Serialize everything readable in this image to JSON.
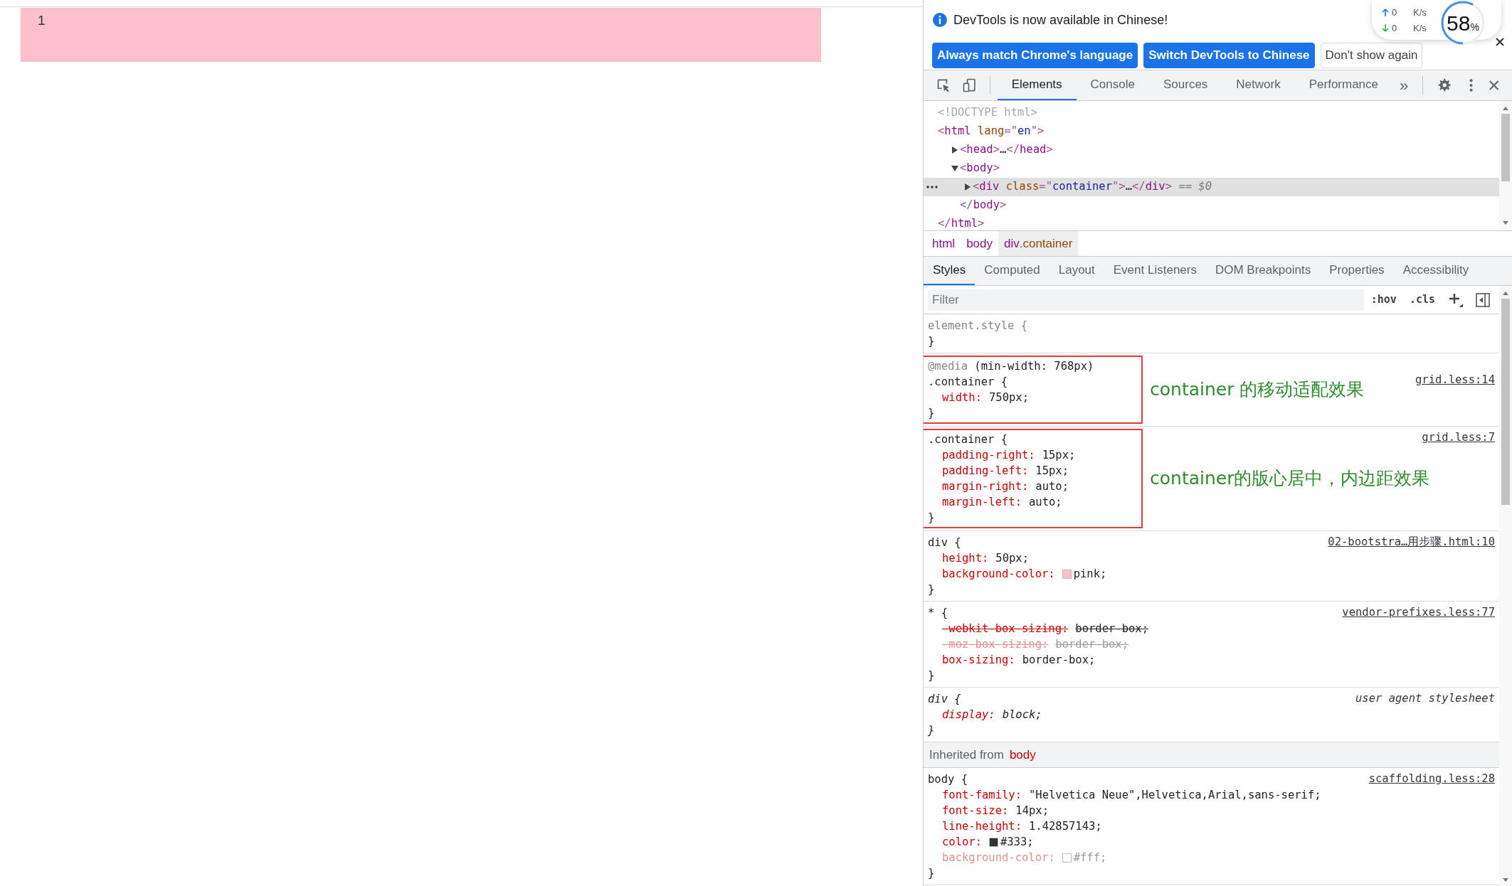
{
  "page": {
    "content_text": "1"
  },
  "infobar": {
    "message": "DevTools is now available in Chinese!",
    "buttons": [
      {
        "label": "Always match Chrome's language",
        "kind": "primary"
      },
      {
        "label": "Switch DevTools to Chinese",
        "kind": "primary"
      },
      {
        "label": "Don't show again",
        "kind": "secondary"
      }
    ]
  },
  "speed_widget": {
    "upload": "0",
    "upload_unit": "K/s",
    "download": "0",
    "download_unit": "K/s",
    "percent": "58",
    "percent_sign": "%",
    "level": 0.58
  },
  "toolbar": {
    "tabs": [
      {
        "label": "Elements",
        "selected": true
      },
      {
        "label": "Console",
        "selected": false
      },
      {
        "label": "Sources",
        "selected": false
      },
      {
        "label": "Network",
        "selected": false
      },
      {
        "label": "Performance",
        "selected": false
      }
    ],
    "more": "»"
  },
  "dom_tree": [
    {
      "tokens": [
        {
          "kind": "doctype",
          "text": "<!DOCTYPE html>"
        }
      ],
      "selected": false
    },
    {
      "tokens": [
        {
          "kind": "punct",
          "text": "<"
        },
        {
          "kind": "tag",
          "text": "html"
        },
        {
          "kind": "attr",
          "text": " lang"
        },
        {
          "kind": "punct",
          "text": "=\""
        },
        {
          "kind": "value",
          "text": "en"
        },
        {
          "kind": "punct",
          "text": "\">"
        }
      ],
      "selected": false,
      "children": [
        {
          "tokens": [
            {
              "kind": "punct",
              "text": "<"
            },
            {
              "kind": "tag",
              "text": "head"
            },
            {
              "kind": "punct",
              "text": ">"
            },
            {
              "kind": "plain",
              "text": "…"
            },
            {
              "kind": "punct",
              "text": "</"
            },
            {
              "kind": "tag",
              "text": "head"
            },
            {
              "kind": "punct",
              "text": ">"
            }
          ],
          "expanded": false,
          "selected": false
        },
        {
          "tokens": [
            {
              "kind": "punct",
              "text": "<"
            },
            {
              "kind": "tag",
              "text": "body"
            },
            {
              "kind": "punct",
              "text": ">"
            }
          ],
          "expanded": true,
          "selected": false,
          "children": [
            {
              "tokens": [
                {
                  "kind": "punct",
                  "text": "<"
                },
                {
                  "kind": "tag",
                  "text": "div"
                },
                {
                  "kind": "attr",
                  "text": " class"
                },
                {
                  "kind": "punct",
                  "text": "=\""
                },
                {
                  "kind": "value",
                  "text": "container"
                },
                {
                  "kind": "punct",
                  "text": "\">"
                },
                {
                  "kind": "plain",
                  "text": "…"
                },
                {
                  "kind": "punct",
                  "text": "</"
                },
                {
                  "kind": "tag",
                  "text": "div"
                },
                {
                  "kind": "punct",
                  "text": ">"
                },
                {
                  "kind": "marker",
                  "text": " == $0"
                }
              ],
              "expanded": false,
              "selected": true
            }
          ],
          "closing": [
            {
              "kind": "punct",
              "text": "</"
            },
            {
              "kind": "tag",
              "text": "body"
            },
            {
              "kind": "punct",
              "text": ">"
            }
          ]
        }
      ],
      "closing": [
        {
          "kind": "punct",
          "text": "</"
        },
        {
          "kind": "tag",
          "text": "html"
        },
        {
          "kind": "punct",
          "text": ">"
        }
      ]
    }
  ],
  "breadcrumbs": [
    {
      "tag": "html",
      "selected": false
    },
    {
      "tag": "body",
      "selected": false
    },
    {
      "tag": "div",
      "class_name": ".container",
      "selected": true
    }
  ],
  "styles_tabs": [
    {
      "label": "Styles",
      "selected": true
    },
    {
      "label": "Computed",
      "selected": false
    },
    {
      "label": "Layout",
      "selected": false
    },
    {
      "label": "Event Listeners",
      "selected": false
    },
    {
      "label": "DOM Breakpoints",
      "selected": false
    },
    {
      "label": "Properties",
      "selected": false
    },
    {
      "label": "Accessibility",
      "selected": false
    }
  ],
  "filter": {
    "placeholder": "Filter",
    "hov": ":hov",
    "cls": ".cls"
  },
  "styles": [
    {
      "kind": "rule",
      "selector": "element.style {",
      "faded_selector": true,
      "user_agent": false,
      "highlighted": false,
      "close": "}"
    },
    {
      "kind": "rule",
      "media": {
        "keyword": "@media",
        "query": " (min-width: 768px)"
      },
      "selector": ".container {",
      "faded_selector": false,
      "user_agent": false,
      "highlighted": true,
      "note": "container 的移动适配效果",
      "source": "grid.less:14",
      "properties": [
        {
          "name": "width:",
          "value": "750px;",
          "struck": false,
          "faded": false
        }
      ],
      "close": "}"
    },
    {
      "kind": "rule",
      "selector": ".container {",
      "faded_selector": false,
      "user_agent": false,
      "highlighted": true,
      "note": "container的版心居中，内边距效果",
      "source": "grid.less:7",
      "properties": [
        {
          "name": "padding-right:",
          "value": "15px;",
          "struck": false,
          "faded": false
        },
        {
          "name": "padding-left:",
          "value": "15px;",
          "struck": false,
          "faded": false
        },
        {
          "name": "margin-right:",
          "value": "auto;",
          "struck": false,
          "faded": false
        },
        {
          "name": "margin-left:",
          "value": "auto;",
          "struck": false,
          "faded": false
        }
      ],
      "close": "}"
    },
    {
      "kind": "rule",
      "selector": "div {",
      "faded_selector": false,
      "user_agent": false,
      "highlighted": false,
      "source": "02-bootstra…用步骤.html:10",
      "properties": [
        {
          "name": "height:",
          "value": "50px;",
          "struck": false,
          "faded": false
        },
        {
          "name": "background-color:",
          "value": "pink;",
          "color": "#ffc0cb",
          "struck": false,
          "faded": false
        }
      ],
      "close": "}"
    },
    {
      "kind": "rule",
      "selector": "* {",
      "faded_selector": false,
      "user_agent": false,
      "highlighted": false,
      "source": "vendor-prefixes.less:77",
      "properties": [
        {
          "name": "-webkit-box-sizing:",
          "value": "border-box;",
          "struck": true,
          "faded": false
        },
        {
          "name": "-moz-box-sizing:",
          "value": "border-box;",
          "struck": true,
          "faded": true
        },
        {
          "name": "box-sizing:",
          "value": "border-box;",
          "struck": false,
          "faded": false
        }
      ],
      "close": "}"
    },
    {
      "kind": "rule",
      "selector": "div {",
      "faded_selector": false,
      "user_agent": true,
      "highlighted": false,
      "source": "user agent stylesheet",
      "properties": [
        {
          "name": "display:",
          "value": "block;",
          "struck": false,
          "faded": false
        }
      ],
      "close": "}"
    },
    {
      "kind": "inherited",
      "label": "Inherited from",
      "element": "body"
    },
    {
      "kind": "rule",
      "selector": "body {",
      "faded_selector": false,
      "user_agent": false,
      "highlighted": false,
      "source": "scaffolding.less:28",
      "properties": [
        {
          "name": "font-family:",
          "value": "\"Helvetica Neue\",Helvetica,Arial,sans-serif;",
          "struck": false,
          "faded": false
        },
        {
          "name": "font-size:",
          "value": "14px;",
          "struck": false,
          "faded": false
        },
        {
          "name": "line-height:",
          "value": "1.42857143;",
          "struck": false,
          "faded": false
        },
        {
          "name": "color:",
          "value": "#333;",
          "color": "#333333",
          "struck": false,
          "faded": false
        },
        {
          "name": "background-color:",
          "value": "#fff;",
          "color": "#ffffff",
          "struck": false,
          "faded": true
        }
      ],
      "close": "}"
    }
  ]
}
